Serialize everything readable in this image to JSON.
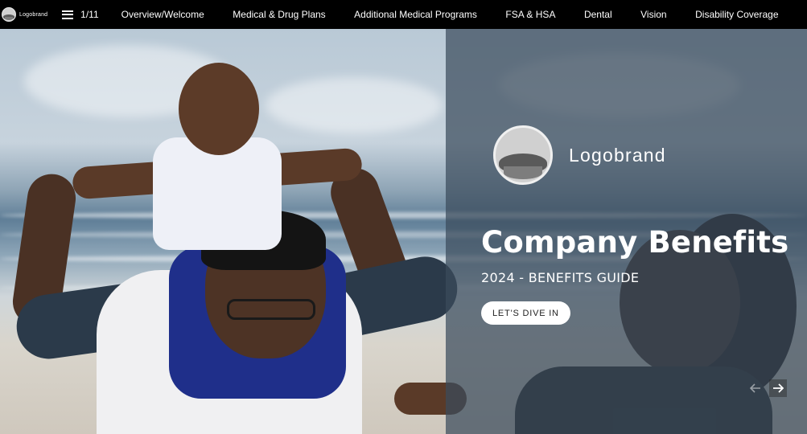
{
  "topbar": {
    "logo_text": "Logobrand",
    "page_indicator": "1/11",
    "nav_items": [
      "Overview/Welcome",
      "Medical & Drug Plans",
      "Additional Medical Programs",
      "FSA & HSA",
      "Dental",
      "Vision",
      "Disability Coverage"
    ]
  },
  "hero": {
    "brand_name": "Logobrand",
    "title": "Company Benefits",
    "subtitle": "2024 - BENEFITS GUIDE",
    "cta_label": "LET'S DIVE IN"
  },
  "icons": {
    "menu": "hamburger-icon",
    "prev": "arrow-left-icon",
    "next": "arrow-right-icon"
  },
  "colors": {
    "nav_background": "#000000",
    "overlay": "#3a4b5c",
    "cta_background": "#ffffff"
  }
}
